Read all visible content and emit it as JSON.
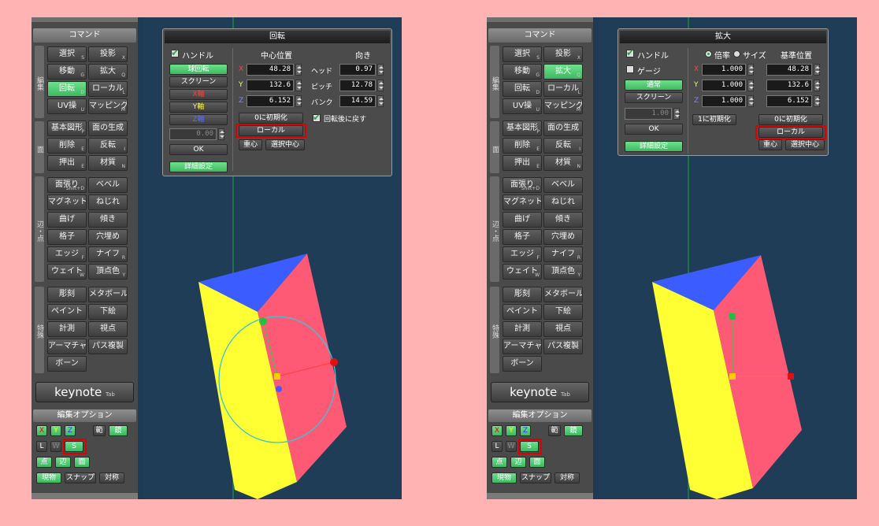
{
  "command_panel": {
    "title": "コマンド",
    "sections": {
      "edit": "編集",
      "face": "面",
      "edge": "辺・点",
      "special": "特殊"
    },
    "buttons": {
      "select": "選択",
      "project": "投影",
      "move": "移動",
      "scale": "拡大",
      "rotate": "回転",
      "local": "ローカル",
      "uv": "UV操",
      "mapping": "マッピング",
      "primitive": "基本図形",
      "face_gen": "面の生成",
      "delete": "削除",
      "flip": "反転",
      "extrude": "押出",
      "material": "材質",
      "face_fill": "面張り",
      "bevel": "ベベル",
      "magnet": "マグネット",
      "twist": "ねじれ",
      "bend": "曲げ",
      "tilt": "傾き",
      "lattice": "格子",
      "fill_hole": "穴埋め",
      "edge": "エッジ",
      "knife": "ナイフ",
      "weight": "ウェイト",
      "vertex_color": "頂点色",
      "sculpt": "彫刻",
      "metaball": "メタボール",
      "paint": "ペイント",
      "underlay": "下絵",
      "measure": "計測",
      "viewpoint": "視点",
      "armature": "アーマチャー",
      "path_copy": "パス複製",
      "bone": "ボーン"
    },
    "shortcuts": {
      "select": "S",
      "project": "X",
      "move": "G",
      "scale": "Q",
      "rotate": "D",
      "local": "L",
      "uv": "U",
      "mapping": "M",
      "primitive": "P",
      "delete": "E",
      "flip": "I",
      "extrude": "E",
      "material": "N",
      "face_fill": "Shift+D",
      "edge": "F",
      "knife": "R",
      "weight": "W",
      "vertex_color": "Y"
    },
    "keynote": "keynote",
    "keynote_sub": "Tab"
  },
  "edit_options": {
    "title": "編集オプション",
    "x": "X",
    "y": "Y",
    "z": "Z",
    "range": "範",
    "mirror": "鏡",
    "l": "L",
    "w": "W",
    "s": "S",
    "point": "点",
    "edge": "辺",
    "face": "面",
    "current": "現物",
    "snap": "スナップ",
    "symmetry": "対称"
  },
  "rotate_dialog": {
    "title": "回転",
    "handle": "ハンドル",
    "center_pos": "中心位置",
    "direction": "向き",
    "sphere_rot": "球回転",
    "screen": "スクリーン",
    "x_axis": "X軸",
    "y_axis": "Y軸",
    "z_axis": "Z軸",
    "x": "X",
    "y": "Y",
    "z": "Z",
    "cx": "48.28",
    "cy": "132.6",
    "cz": "6.152",
    "head_label": "ヘッド",
    "pitch_label": "ピッチ",
    "bank_label": "バンク",
    "head": "0.97",
    "pitch": "12.78",
    "bank": "14.59",
    "value": "0.00",
    "ok": "OK",
    "reset": "0に初期化",
    "restore": "回転後に戻す",
    "local": "ローカル",
    "gravity": "重心",
    "sel_center": "選択中心",
    "detail": "詳細設定"
  },
  "scale_dialog": {
    "title": "拡大",
    "handle": "ハンドル",
    "ratio": "倍率",
    "size": "サイズ",
    "base_pos": "基準位置",
    "gauge": "ゲージ",
    "normal": "通常",
    "screen": "スクリーン",
    "x": "X",
    "y": "Y",
    "z": "Z",
    "sx": "1.000",
    "sy": "1.000",
    "sz": "1.000",
    "bx": "48.28",
    "by": "132.6",
    "bz": "6.152",
    "value": "1.00",
    "ok": "OK",
    "reset1": "1に初期化",
    "reset0": "0に初期化",
    "local": "ローカル",
    "gravity": "重心",
    "sel_center": "選択中心",
    "detail": "詳細設定"
  },
  "colors": {
    "accent_green": "#3eb862",
    "highlight_red": "#e00000",
    "viewport_bg": "#1f3d57"
  }
}
